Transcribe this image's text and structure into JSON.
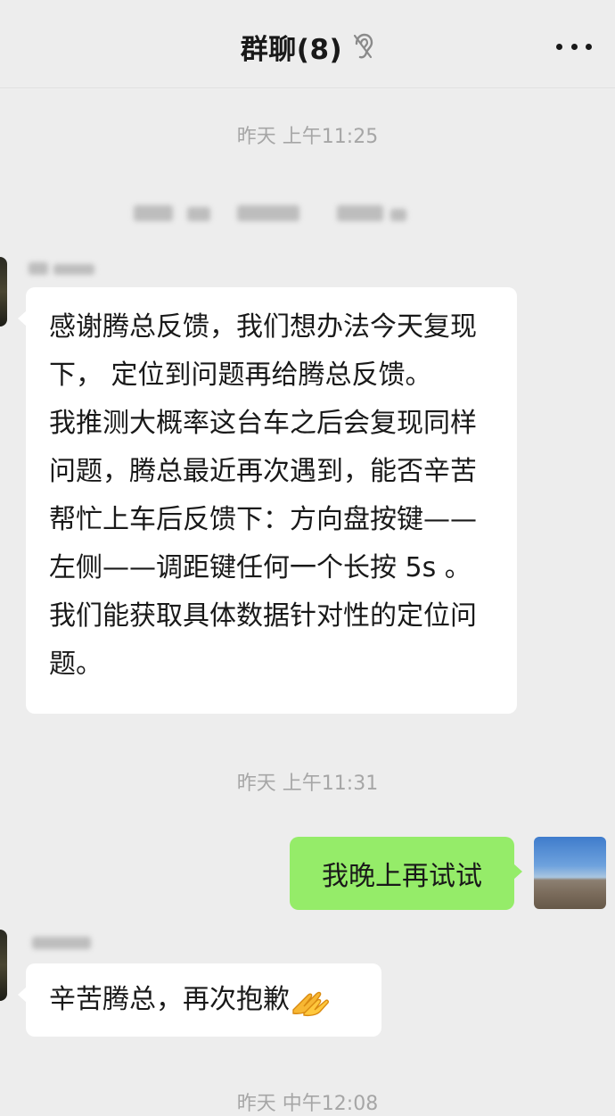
{
  "header": {
    "title": "群聊(8)",
    "mute_icon": "ear-icon",
    "more_icon": "more-icon"
  },
  "messages": {
    "time_1": "昨天 上午11:25",
    "msg1_paragraphs": [
      "感谢腾总反馈，我们想办法今天复现下， 定位到问题再给腾总反馈。",
      "我推测大概率这台车之后会复现同样问题，腾总最近再次遇到，能否辛苦帮忙上车后反馈下：方向盘按键——左侧——调距键任何一个长按 5s 。我们能获取具体数据针对性的定位问题。"
    ],
    "time_2": "昨天 上午11:31",
    "msg2_text": "我晚上再试试",
    "msg3_text": "辛苦腾总，再次抱歉",
    "msg3_emoji": "folded-hands-icon",
    "time_3_partial": "昨天 中午12:08"
  },
  "colors": {
    "background": "#ededed",
    "bubble_incoming": "#ffffff",
    "bubble_outgoing": "#95ec69",
    "timestamp": "#a6a6a6"
  }
}
